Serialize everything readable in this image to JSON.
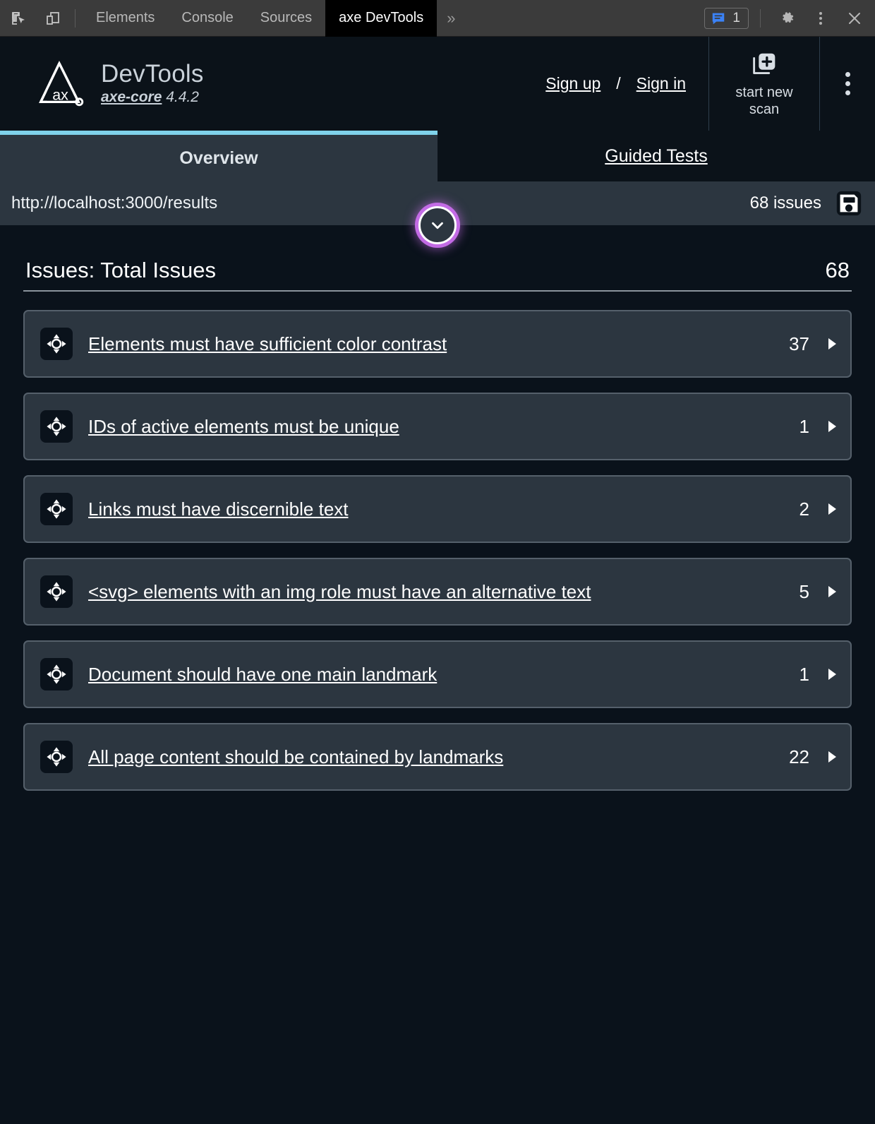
{
  "devtools_bar": {
    "icons": {
      "inspect": "inspect-element-icon",
      "device": "device-toolbar-icon",
      "gear": "settings-gear-icon",
      "kebab": "more-options-icon",
      "close": "close-icon",
      "messages": "messages-icon"
    },
    "tabs": [
      {
        "label": "Elements",
        "active": false
      },
      {
        "label": "Console",
        "active": false
      },
      {
        "label": "Sources",
        "active": false
      },
      {
        "label": "axe DevTools",
        "active": true
      }
    ],
    "overflow_label": "»",
    "message_count": "1",
    "close_label": "✕",
    "accent_blue": "#3b82f6"
  },
  "header": {
    "logo_name": "axe-logo",
    "logo_letters": "ax",
    "title": "DevTools",
    "subtitle_product": "axe-core",
    "subtitle_version": "4.4.2",
    "sign_up": "Sign up",
    "separator": "/",
    "sign_in": "Sign in",
    "scan_button_line1": "start new",
    "scan_button_line2": "scan",
    "scan_icon": "new-scan-icon",
    "kebab": "header-more-options-icon"
  },
  "tabs": {
    "overview": "Overview",
    "guided_tests": "Guided Tests",
    "active": "Overview",
    "active_indicator_color": "#7fd2ea"
  },
  "urlbar": {
    "url": "http://localhost:3000/results",
    "issues_label": "68 issues",
    "save_icon": "save-icon",
    "collapse_icon": "chevron-down-icon",
    "focus_ring_color": "#c86eeb"
  },
  "panel": {
    "title": "Issues: Total Issues",
    "total": "68",
    "issues": [
      {
        "icon": "crosshair-icon",
        "label": "Elements must have sufficient color contrast",
        "count": "37",
        "caret": "chevron-right-icon"
      },
      {
        "icon": "crosshair-icon",
        "label": "IDs of active elements must be unique",
        "count": "1",
        "caret": "chevron-right-icon"
      },
      {
        "icon": "crosshair-icon",
        "label": "Links must have discernible text",
        "count": "2",
        "caret": "chevron-right-icon"
      },
      {
        "icon": "crosshair-icon",
        "label": "<svg> elements with an img role must have an alternative text",
        "count": "5",
        "caret": "chevron-right-icon"
      },
      {
        "icon": "crosshair-icon",
        "label": "Document should have one main landmark",
        "count": "1",
        "caret": "chevron-right-icon"
      },
      {
        "icon": "crosshair-icon",
        "label": "All page content should be contained by landmarks",
        "count": "22",
        "caret": "chevron-right-icon"
      }
    ]
  },
  "colors": {
    "app_background": "#0a121b",
    "header_background": "#0b1219",
    "panel_card": "#2c3640",
    "card_border": "#55606b",
    "devtools_chrome": "#3b3b3b"
  }
}
